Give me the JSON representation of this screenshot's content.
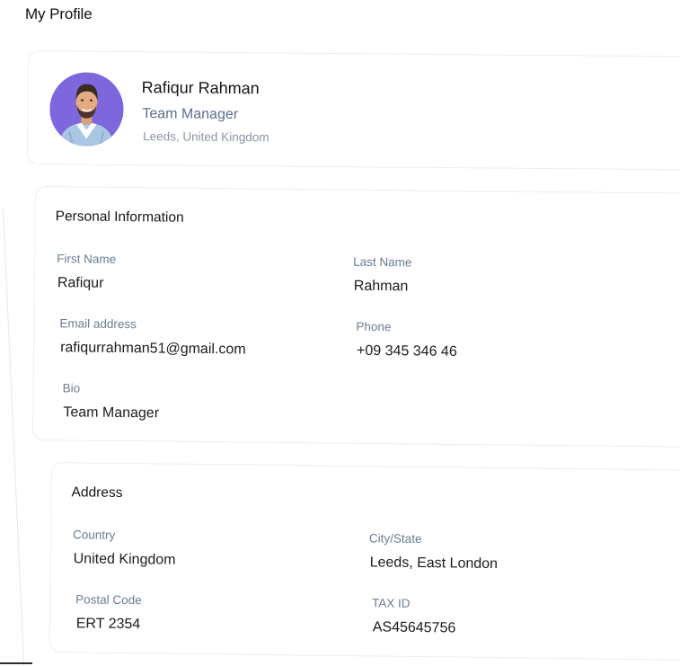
{
  "page": {
    "title": "My Profile"
  },
  "profile": {
    "name": "Rafiqur Rahman",
    "role": "Team Manager",
    "location": "Leeds, United Kingdom",
    "avatar_background": "#7e67dc"
  },
  "personal": {
    "title": "Personal Information",
    "first_name": {
      "label": "First Name",
      "value": "Rafiqur"
    },
    "last_name": {
      "label": "Last Name",
      "value": "Rahman"
    },
    "email": {
      "label": "Email address",
      "value": "rafiqurrahman51@gmail.com"
    },
    "phone": {
      "label": "Phone",
      "value": "+09 345 346 46"
    },
    "bio": {
      "label": "Bio",
      "value": "Team Manager"
    }
  },
  "address": {
    "title": "Address",
    "country": {
      "label": "Country",
      "value": "United Kingdom"
    },
    "city_state": {
      "label": "City/State",
      "value": "Leeds, East London"
    },
    "postal_code": {
      "label": "Postal Code",
      "value": "ERT 2354"
    },
    "tax_id": {
      "label": "TAX ID",
      "value": "AS45645756"
    }
  }
}
